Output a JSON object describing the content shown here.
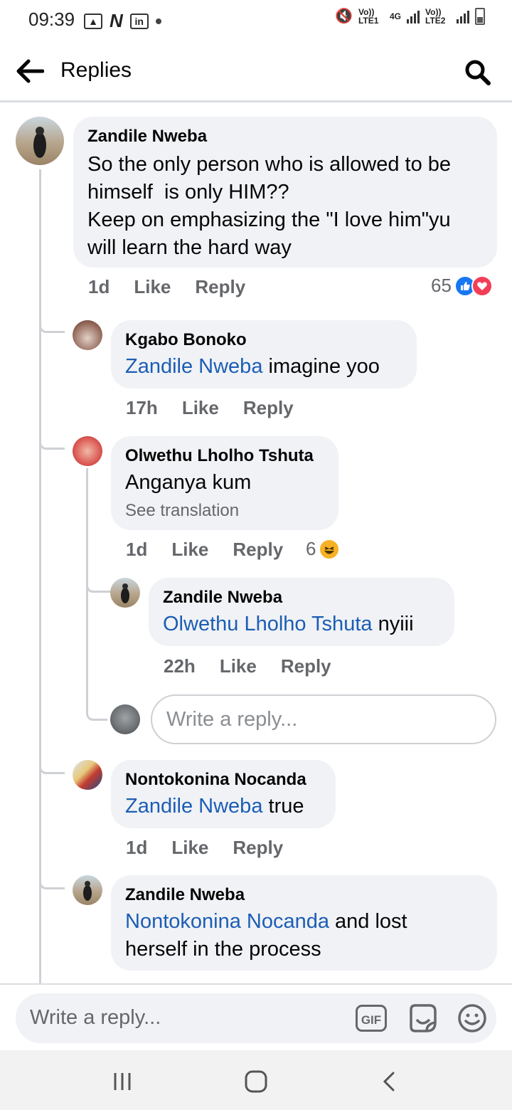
{
  "status_bar": {
    "time": "09:39",
    "sim1": "Vo)) LTE1",
    "net": "4G",
    "sim2": "Vo)) LTE2"
  },
  "header": {
    "title": "Replies",
    "back_icon": "arrow-left-icon",
    "search_icon": "search-icon"
  },
  "comments": [
    {
      "author": "Zandile Nweba",
      "lines": [
        "So the only person who is allowed to be",
        "himself  is only HIM??",
        "Keep on emphasizing the \"I love him\"yu",
        "will learn the hard way"
      ],
      "time": "1d",
      "like": "Like",
      "reply": "Reply",
      "reaction_count": "65",
      "reactions": [
        "like",
        "love"
      ]
    },
    {
      "author": "Kgabo Bonoko",
      "mention": "Zandile Nweba",
      "text": " imagine yoo",
      "time": "17h",
      "like": "Like",
      "reply": "Reply"
    },
    {
      "author": "Olwethu Lholho Tshuta",
      "text": "Anganya kum",
      "translation": "See translation",
      "time": "1d",
      "like": "Like",
      "reply": "Reply",
      "reaction_count": "6",
      "reactions": [
        "haha"
      ]
    },
    {
      "author": "Zandile Nweba",
      "mention": "Olwethu Lholho Tshuta",
      "text": " nyiii",
      "time": "22h",
      "like": "Like",
      "reply": "Reply"
    },
    {
      "author": "Nontokonina Nocanda",
      "mention": "Zandile Nweba",
      "text": " true",
      "time": "1d",
      "like": "Like",
      "reply": "Reply"
    },
    {
      "author": "Zandile Nweba",
      "mention": "Nontokonina Nocanda",
      "text_line1": " and lost",
      "text_line2": "herself in the process"
    }
  ],
  "nested_reply_placeholder": "Write a reply...",
  "composer": {
    "placeholder": "Write a reply...",
    "gif_label": "GIF"
  },
  "colors": {
    "mention": "#1c5db5",
    "like_blue": "#1877f2",
    "love_red": "#f33e58",
    "haha_yellow": "#f7b125",
    "bubble": "#f0f2f5"
  }
}
